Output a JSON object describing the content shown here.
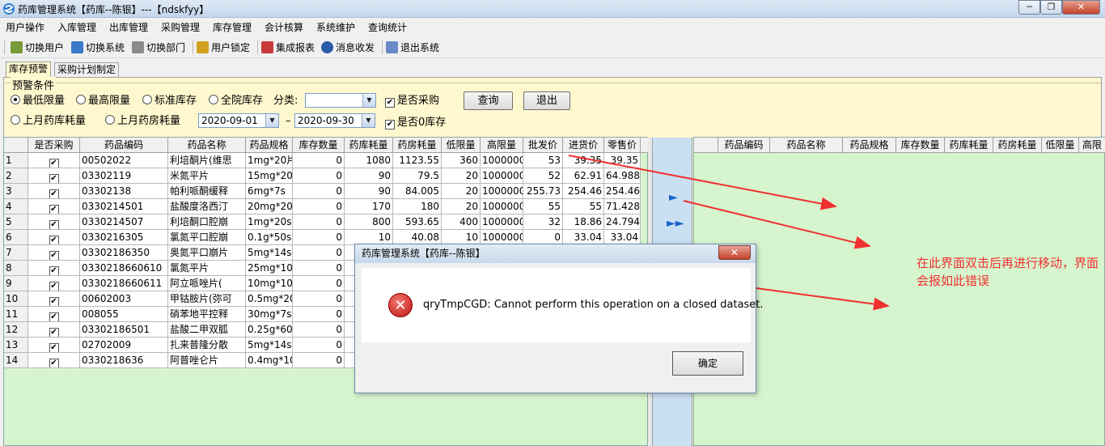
{
  "window": {
    "title": "药库管理系统【药库--陈银】---【ndskfyy】",
    "min": "─",
    "restore": "❐",
    "close": "✕"
  },
  "menu": [
    "用户操作",
    "入库管理",
    "出库管理",
    "采购管理",
    "库存管理",
    "会计核算",
    "系统维护",
    "查询统计"
  ],
  "toolbar": [
    "切换用户",
    "切换系统",
    "切换部门",
    "用户锁定",
    "集成报表",
    "消息收发",
    "退出系统"
  ],
  "tabs": [
    "库存预警",
    "采购计划制定"
  ],
  "conditions": {
    "legend": "预警条件",
    "radios": [
      "最低限量",
      "最高限量",
      "标准库存",
      "全院库存",
      "上月药库耗量",
      "上月药房耗量"
    ],
    "category_label": "分类:",
    "category_value": "",
    "purchase_check": "是否采购",
    "zero_stock_check": "是否0库存",
    "date_from": "2020-09-01",
    "date_sep": "–",
    "date_to": "2020-09-30",
    "query_btn": "查询",
    "exit_btn": "退出"
  },
  "left_grid": {
    "headers": [
      "",
      "是否采购",
      "药品编码",
      "药品名称",
      "药品规格",
      "库存数量",
      "药库耗量",
      "药房耗量",
      "低限量",
      "高限量",
      "批发价",
      "进货价",
      "零售价"
    ],
    "rows": [
      [
        "1",
        "✔",
        "00502022",
        "利培酮片(维思",
        "1mg*20片",
        "0",
        "1080",
        "1123.55",
        "360",
        "1000000",
        "53",
        "39.35",
        "39.35"
      ],
      [
        "2",
        "✔",
        "03302119",
        "米氮平片",
        "15mg*20",
        "0",
        "90",
        "79.5",
        "20",
        "1000000",
        "52",
        "62.91",
        "64.988"
      ],
      [
        "3",
        "✔",
        "03302138",
        "帕利哌酮缓释",
        "6mg*7s",
        "0",
        "90",
        "84.005",
        "20",
        "1000000",
        "255.73",
        "254.46",
        "254.46"
      ],
      [
        "4",
        "✔",
        "0330214501",
        "盐酸度洛西汀",
        "20mg*20s",
        "0",
        "170",
        "180",
        "20",
        "1000000",
        "55",
        "55",
        "71.428"
      ],
      [
        "5",
        "✔",
        "0330214507",
        "利培酮口腔崩",
        "1mg*20s",
        "0",
        "800",
        "593.65",
        "400",
        "1000000",
        "32",
        "18.86",
        "24.794"
      ],
      [
        "6",
        "✔",
        "0330216305",
        "氯氮平口腔崩",
        "0.1g*50s",
        "0",
        "10",
        "40.08",
        "10",
        "1000000",
        "0",
        "33.04",
        "33.04"
      ],
      [
        "7",
        "✔",
        "03302186350",
        "奥氮平口崩片",
        "5mg*14s",
        "0",
        "",
        "",
        "",
        "",
        "",
        "",
        ""
      ],
      [
        "8",
        "✔",
        "0330218660610",
        "氯氮平片",
        "25mg*100s",
        "0",
        "",
        "",
        "",
        "",
        "",
        "",
        ""
      ],
      [
        "9",
        "✔",
        "0330218660611",
        "阿立哌唑片(",
        "10mg*10s",
        "0",
        "",
        "",
        "",
        "",
        "",
        "",
        ""
      ],
      [
        "10",
        "✔",
        "00602003",
        "甲钴胺片(弥可",
        "0.5mg*20s",
        "0",
        "",
        "",
        "",
        "",
        "",
        "",
        ""
      ],
      [
        "11",
        "✔",
        "008055",
        "硝苯地平控释",
        "30mg*7s",
        "0",
        "",
        "",
        "",
        "",
        "",
        "",
        ""
      ],
      [
        "12",
        "✔",
        "03302186501",
        "盐酸二甲双胍",
        "0.25g*60s",
        "0",
        "",
        "",
        "",
        "",
        "",
        "",
        ""
      ],
      [
        "13",
        "✔",
        "02702009",
        "扎来普隆分散",
        "5mg*14s",
        "0",
        "",
        "",
        "",
        "",
        "",
        "",
        ""
      ],
      [
        "14",
        "✔",
        "0330218636",
        "阿普唑仑片",
        "0.4mg*100",
        "0",
        "",
        "",
        "",
        "",
        "",
        "",
        ""
      ]
    ]
  },
  "right_grid": {
    "headers": [
      "",
      "药品编码",
      "药品名称",
      "药品规格",
      "库存数量",
      "药库耗量",
      "药房耗量",
      "低限量",
      "高限"
    ]
  },
  "dialog": {
    "title": "药库管理系统【药库--陈银】",
    "close": "✕",
    "message": "qryTmpCGD: Cannot perform this operation on a closed dataset.",
    "ok": "确定",
    "icon": "error-icon"
  },
  "annotation": "在此界面双击后再进行移动，界面会报如此错误",
  "colors": {
    "grid_bg": "#d6f5ce",
    "panel_bg": "#fff8cf",
    "annotation": "#f03030"
  }
}
